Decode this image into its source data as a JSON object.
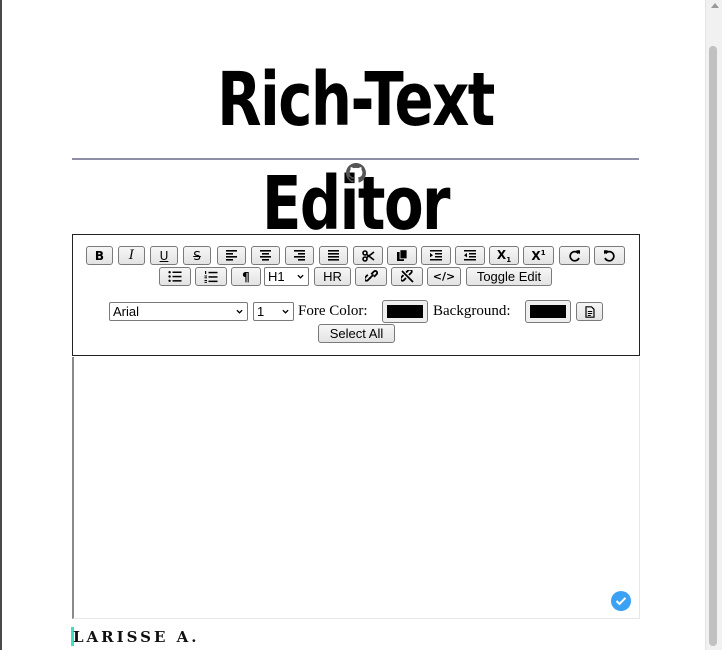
{
  "page": {
    "title": "Rich-Text Editor",
    "author": "LARISSE A.",
    "accent_colors": {
      "title_rule": "#8e8ea6",
      "check_badge": "#3aa1f5",
      "caret": "#3fe0c8"
    }
  },
  "toolbar": {
    "row1": [
      {
        "name": "bold",
        "label": "B"
      },
      {
        "name": "italic",
        "label": "I"
      },
      {
        "name": "underline",
        "label": "U"
      },
      {
        "name": "strikethrough",
        "label": "S"
      },
      {
        "name": "align-left",
        "icon": "align-left-icon"
      },
      {
        "name": "align-center",
        "icon": "align-center-icon"
      },
      {
        "name": "align-right",
        "icon": "align-right-icon"
      },
      {
        "name": "justify",
        "icon": "align-justify-icon"
      },
      {
        "name": "cut",
        "icon": "scissors-icon"
      },
      {
        "name": "copy",
        "icon": "copy-icon"
      },
      {
        "name": "indent",
        "icon": "indent-icon"
      },
      {
        "name": "outdent",
        "icon": "outdent-icon"
      },
      {
        "name": "subscript",
        "label": "X",
        "small": "1"
      },
      {
        "name": "superscript",
        "label": "X",
        "small": "1"
      },
      {
        "name": "redo",
        "icon": "redo-icon"
      },
      {
        "name": "undo",
        "icon": "undo-icon"
      }
    ],
    "row2": {
      "unordered_list_icon": "bullet-list-icon",
      "ordered_list_icon": "numbered-list-icon",
      "paragraph_label": "¶",
      "heading_select_value": "H1",
      "hr_label": "HR",
      "link_icon": "link-icon",
      "unlink_icon": "unlink-icon",
      "code_label": "</>",
      "toggle_edit_label": "Toggle Edit"
    },
    "row3": {
      "font_select_value": "Arial",
      "size_select_value": "1",
      "fore_color_label": "Fore Color:",
      "fore_color_value": "#000000",
      "background_label": "Background:",
      "background_value": "#000000",
      "export_icon": "document-icon"
    },
    "row4": {
      "select_all_label": "Select All"
    }
  },
  "editor": {
    "content": "",
    "status_icon": "check-circle-icon"
  }
}
